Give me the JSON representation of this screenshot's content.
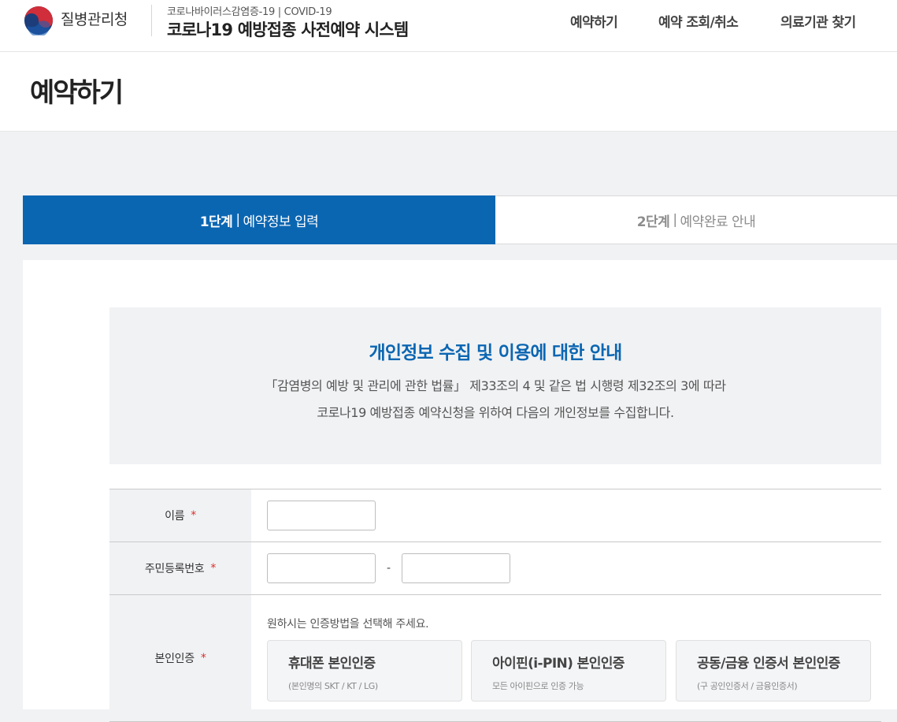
{
  "header": {
    "org_name": "질병관리청",
    "subtitle": "코로나바이러스감염증-19 | COVID-19",
    "system_title": "코로나19 예방접종 사전예약 시스템",
    "nav": [
      "예약하기",
      "예약 조회/취소",
      "의료기관 찾기"
    ]
  },
  "page_title": "예약하기",
  "steps": [
    {
      "num": "1단계",
      "label": "예약정보 입력",
      "active": true
    },
    {
      "num": "2단계",
      "label": "예약완료 안내",
      "active": false
    }
  ],
  "notice": {
    "title": "개인정보 수집 및 이용에 대한 안내",
    "line1": "「감염병의 예방 및 관리에 관한 법률」 제33조의 4 및 같은 법 시행령 제32조의 3에 따라",
    "line2": "코로나19 예방접종 예약신청을 위하여 다음의 개인정보를 수집합니다."
  },
  "form": {
    "required_mark": "*",
    "name_label": "이름",
    "name_value": "",
    "rrn_label": "주민등록번호",
    "rrn_front": "",
    "rrn_back": "",
    "rrn_dash": "-",
    "auth_label": "본인인증",
    "auth_guide": "원하시는 인증방법을 선택해 주세요.",
    "auth_options": [
      {
        "title": "휴대폰 본인인증",
        "sub": "(본인명의 SKT / KT / LG)"
      },
      {
        "title": "아이핀(i-PIN) 본인인증",
        "sub": "모든 아이핀으로 인증 가능"
      },
      {
        "title": "공동/금융 인증서 본인인증",
        "sub": "(구 공인인증서 / 금융인증서)"
      }
    ]
  },
  "colors": {
    "primary": "#0b66b2",
    "required": "#d9302b",
    "background": "#f1f2f4"
  },
  "icons": [
    "korea-government-emblem-icon"
  ]
}
